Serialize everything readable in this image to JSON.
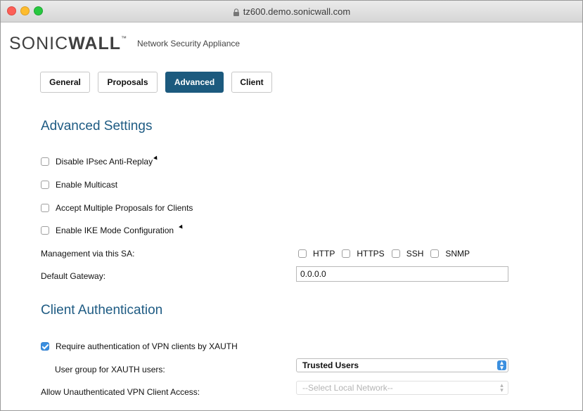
{
  "browser": {
    "url": "tz600.demo.sonicwall.com"
  },
  "brand": {
    "logo_light": "SONIC",
    "logo_bold": "WALL",
    "logo_tm": "™",
    "subtitle": "Network Security Appliance"
  },
  "tabs": [
    {
      "label": "General",
      "active": false
    },
    {
      "label": "Proposals",
      "active": false
    },
    {
      "label": "Advanced",
      "active": true
    },
    {
      "label": "Client",
      "active": false
    }
  ],
  "advanced": {
    "title": "Advanced Settings",
    "checkboxes": [
      {
        "label": "Disable IPsec Anti-Replay",
        "checked": false
      },
      {
        "label": "Enable Multicast",
        "checked": false
      },
      {
        "label": "Accept Multiple Proposals for Clients",
        "checked": false
      },
      {
        "label": "Enable IKE Mode Configuration",
        "checked": false
      }
    ],
    "management_label": "Management via this SA:",
    "management_options": [
      {
        "label": "HTTP",
        "checked": false
      },
      {
        "label": "HTTPS",
        "checked": false
      },
      {
        "label": "SSH",
        "checked": false
      },
      {
        "label": "SNMP",
        "checked": false
      }
    ],
    "default_gateway_label": "Default Gateway:",
    "default_gateway_value": "0.0.0.0"
  },
  "client_auth": {
    "title": "Client Authentication",
    "require_xauth_label": "Require authentication of VPN clients by XAUTH",
    "require_xauth_checked": true,
    "user_group_label": "User group for XAUTH users:",
    "user_group_value": "Trusted Users",
    "unauth_label": "Allow Unauthenticated VPN Client Access:",
    "unauth_value": "--Select Local Network--"
  },
  "colors": {
    "accent": "#1c5a7e",
    "section_title": "#1e5b83",
    "checkbox_checked": "#3b8fdf"
  }
}
